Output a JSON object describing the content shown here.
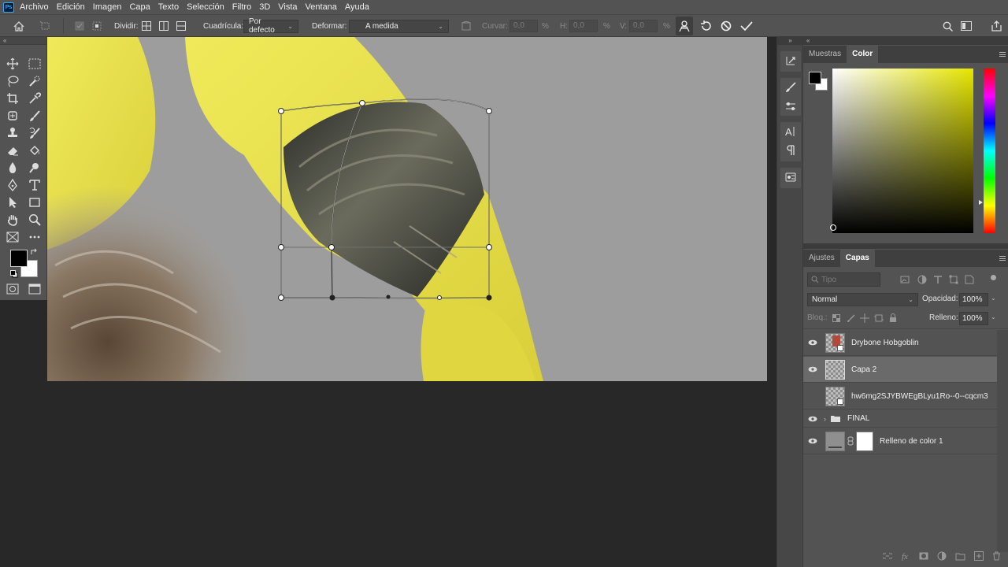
{
  "app": {
    "logo": "Ps"
  },
  "menu": [
    "Archivo",
    "Edición",
    "Imagen",
    "Capa",
    "Texto",
    "Selección",
    "Filtro",
    "3D",
    "Vista",
    "Ventana",
    "Ayuda"
  ],
  "options": {
    "dividir_label": "Dividir:",
    "cuadricula_label": "Cuadrícula:",
    "cuadricula_value": "Por defecto",
    "deformar_label": "Deformar:",
    "deformar_value": "A medida",
    "curvar_label": "Curvar:",
    "curvar_value": "0,0",
    "h_label": "H:",
    "h_value": "0,0",
    "v_label": "V:",
    "v_value": "0,0",
    "percent": "%"
  },
  "swatch_panel": {
    "tabs": [
      "Muestras",
      "Color"
    ],
    "active_tab": "Color",
    "foreground": "#000000",
    "background": "#ffffff",
    "hue_color": "#e6e600"
  },
  "layers_panel": {
    "tabs": [
      "Ajustes",
      "Capas"
    ],
    "active_tab": "Capas",
    "filter_placeholder": "Tipo",
    "blend_mode": "Normal",
    "opacity_label": "Opacidad:",
    "opacity_value": "100%",
    "lock_label": "Bloq.:",
    "fill_label": "Relleno:",
    "fill_value": "100%",
    "layers": [
      {
        "name": "Drybone Hobgoblin",
        "visible": true,
        "selected": false
      },
      {
        "name": "Capa 2",
        "visible": true,
        "selected": true
      },
      {
        "name": "hw6mg2SJYBWEgBLyu1Ro--0--cqcm3",
        "visible": false,
        "selected": false
      },
      {
        "name": "FINAL",
        "visible": true,
        "selected": false
      },
      {
        "name": "Relleno de color 1",
        "visible": true,
        "selected": false
      }
    ]
  }
}
